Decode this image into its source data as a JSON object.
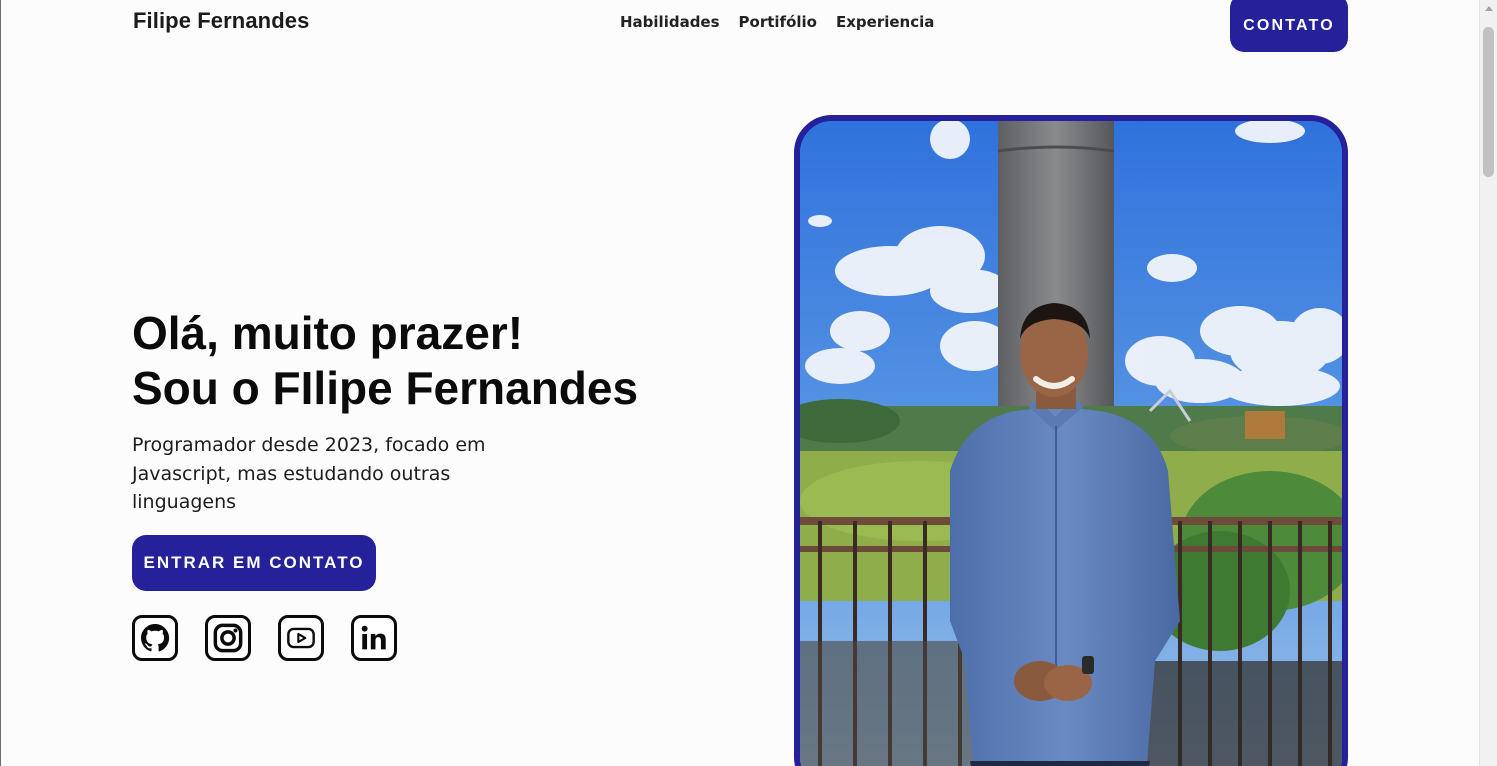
{
  "header": {
    "logo": "Filipe Fernandes",
    "nav": [
      "Habilidades",
      "Portifólio",
      "Experiencia"
    ],
    "contact_label": "CONTATO"
  },
  "hero": {
    "title_line1": "Olá, muito prazer!",
    "title_line2": "Sou o FIlipe Fernandes",
    "description": "Programador desde 2023, focado em Javascript, mas estudando outras linguagens",
    "cta_label": "ENTRAR EM CONTATO"
  },
  "socials": [
    {
      "name": "github",
      "icon": "github-icon"
    },
    {
      "name": "instagram",
      "icon": "instagram-icon"
    },
    {
      "name": "youtube",
      "icon": "youtube-icon"
    },
    {
      "name": "linkedin",
      "icon": "linkedin-icon"
    }
  ],
  "colors": {
    "accent": "#24219a",
    "text": "#111111",
    "background": "#fdfcfc"
  }
}
